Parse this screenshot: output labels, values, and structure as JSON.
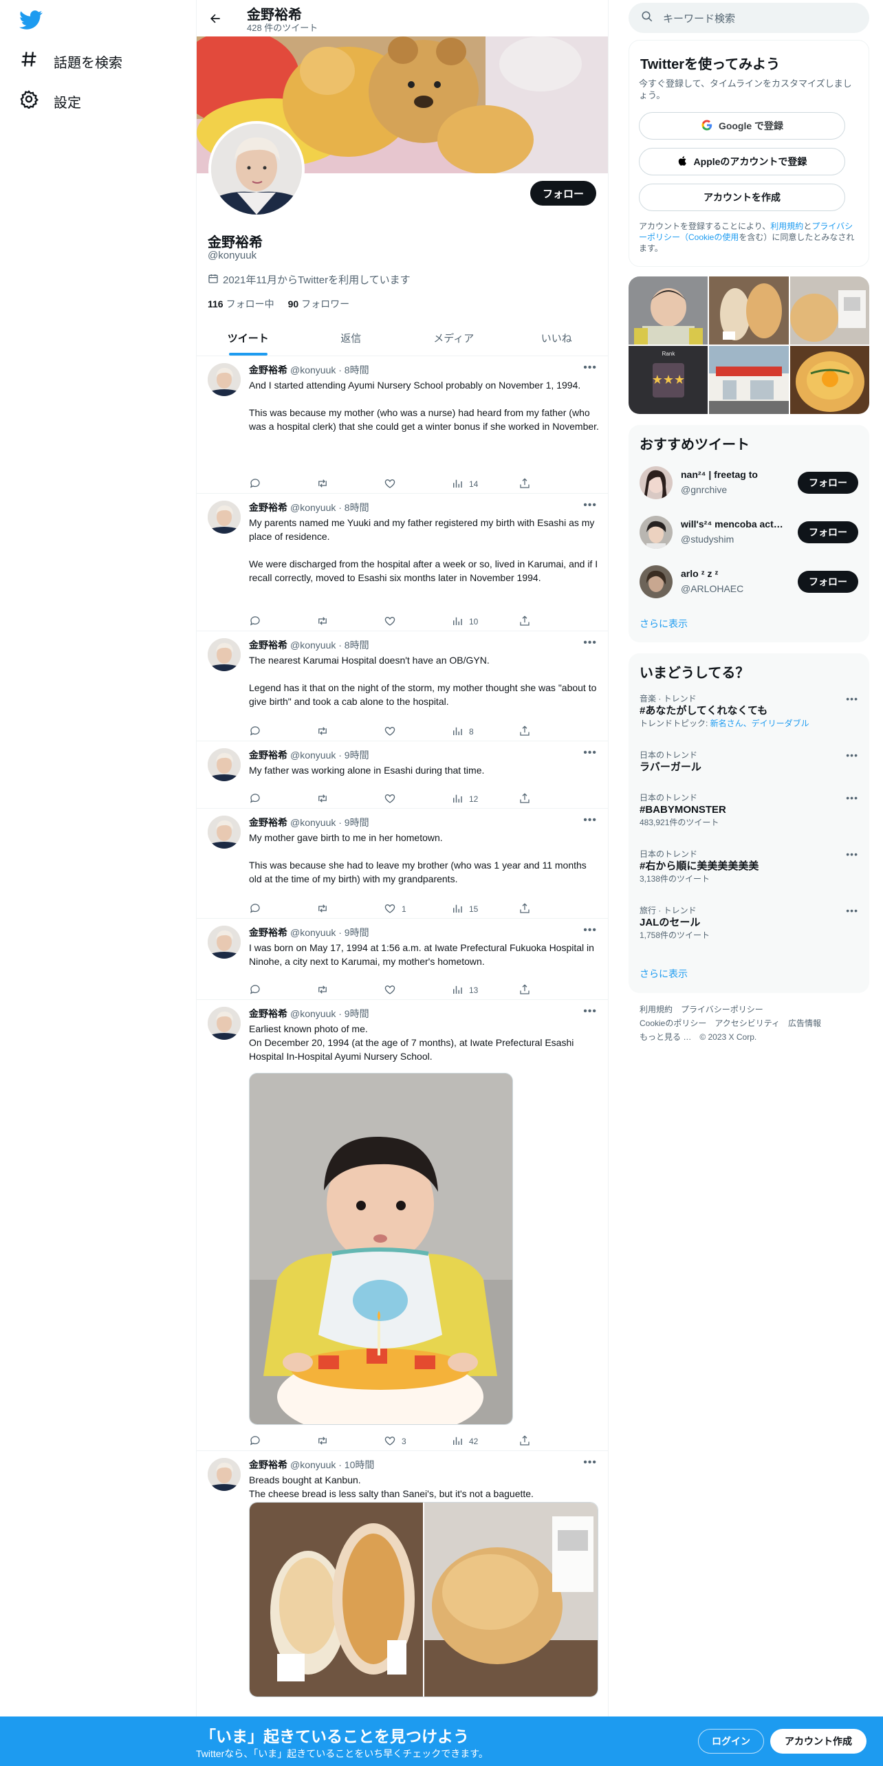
{
  "nav": {
    "logo_icon": "twitter-bird-icon",
    "items": [
      {
        "label": "話題を検索",
        "icon": "hashtag-icon"
      },
      {
        "label": "設定",
        "icon": "gear-icon"
      }
    ]
  },
  "header": {
    "name": "金野裕希",
    "tweet_count": "428 件のツイート"
  },
  "profile": {
    "name": "金野裕希",
    "handle": "@konyuuk",
    "joined": "2021年11月からTwitterを利用しています",
    "following_count": "116",
    "following_label": "フォロー中",
    "followers_count": "90",
    "followers_label": "フォロワー",
    "follow_button": "フォロー"
  },
  "tabs": [
    "ツイート",
    "返信",
    "メディア",
    "いいね"
  ],
  "tweets": [
    {
      "name": "金野裕希",
      "handle": "@konyuuk",
      "time": "· 8時間",
      "text": "And I started attending Ayumi Nursery School probably on November 1, 1994.\n\nThis was because my mother (who was a nurse) had heard from my father (who was a hospital clerk) that she could get a winter bonus if she worked in November.",
      "likes": "",
      "views": "14"
    },
    {
      "name": "金野裕希",
      "handle": "@konyuuk",
      "time": "· 8時間",
      "text": "My parents named me Yuuki and my father registered my birth with Esashi as my place of residence.\n\nWe were discharged from the hospital after a week or so, lived in Karumai, and if I recall correctly, moved to Esashi six months later in November 1994.",
      "likes": "",
      "views": "10"
    },
    {
      "name": "金野裕希",
      "handle": "@konyuuk",
      "time": "· 8時間",
      "text": "The nearest Karumai Hospital doesn't have an OB/GYN.\n\nLegend has it that on the night of the storm, my mother thought she was \"about to give birth\" and took a cab alone to the hospital.",
      "likes": "",
      "views": "8"
    },
    {
      "name": "金野裕希",
      "handle": "@konyuuk",
      "time": "· 9時間",
      "text": "My father was working alone in Esashi during that time.",
      "likes": "",
      "views": "12"
    },
    {
      "name": "金野裕希",
      "handle": "@konyuuk",
      "time": "· 9時間",
      "text": "My mother gave birth to me in her hometown.\n\nThis was because she had to leave my brother (who was 1 year and 11 months old at the time of my birth) with my grandparents.",
      "likes": "1",
      "views": "15"
    },
    {
      "name": "金野裕希",
      "handle": "@konyuuk",
      "time": "· 9時間",
      "text": "I was born on May 17, 1994 at 1:56 a.m. at Iwate Prefectural Fukuoka Hospital in Ninohe, a city next to Karumai, my mother's hometown.",
      "likes": "",
      "views": "13"
    },
    {
      "name": "金野裕希",
      "handle": "@konyuuk",
      "time": "· 9時間",
      "text": "Earliest known photo of me.\nOn December 20, 1994 (at the age of 7 months), at Iwate Prefectural Esashi Hospital In-Hospital Ayumi Nursery School.",
      "likes": "3",
      "views": "42"
    },
    {
      "name": "金野裕希",
      "handle": "@konyuuk",
      "time": "· 10時間",
      "text": "Breads bought at Kanbun.\nThe cheese bread is less salty than Sanei's, but it's not a baguette.",
      "likes": "",
      "views": ""
    }
  ],
  "search": {
    "placeholder": "キーワード検索"
  },
  "signup": {
    "title": "Twitterを使ってみよう",
    "subtitle": "今すぐ登録して、タイムラインをカスタマイズしましょう。",
    "google": "Google で登録",
    "apple": "Appleのアカウントで登録",
    "create": "アカウントを作成",
    "terms_1": "アカウントを登録することにより、",
    "terms_link1": "利用規約",
    "terms_2": "と",
    "terms_link2": "プライバシーポリシー（Cookieの使用",
    "terms_3": "を含む）に同意したとみなされます。"
  },
  "recommended": {
    "title": "おすすめツイート",
    "users": [
      {
        "name": "nan²⁴ | freetag to",
        "handle": "@gnrchive",
        "button": "フォロー"
      },
      {
        "name": "will's²⁴ mencoba acti...",
        "handle": "@studyshim",
        "button": "フォロー"
      },
      {
        "name": "arlo ᶻ z ᶻ",
        "handle": "@ARLOHAEC",
        "button": "フォロー"
      }
    ],
    "more": "さらに表示"
  },
  "trends": {
    "title": "いまどうしてる？",
    "items": [
      {
        "meta": "音楽 · トレンド",
        "name": "#あなたがしてくれなくても",
        "sub_prefix": "トレンドトピック: ",
        "sub_link": "新名さん、デイリーダブル"
      },
      {
        "meta": "日本のトレンド",
        "name": "ラバーガール",
        "sub_prefix": "",
        "sub_link": ""
      },
      {
        "meta": "日本のトレンド",
        "name": "#BABYMONSTER",
        "sub_prefix": "483,921件のツイート",
        "sub_link": ""
      },
      {
        "meta": "日本のトレンド",
        "name": "#右から順に美美美美美美",
        "sub_prefix": "3,138件のツイート",
        "sub_link": ""
      },
      {
        "meta": "旅行 · トレンド",
        "name": "JALのセール",
        "sub_prefix": "1,758件のツイート",
        "sub_link": ""
      }
    ],
    "more": "さらに表示"
  },
  "footer": {
    "line1": "利用規約　プライバシーポリシー",
    "line2": "Cookieのポリシー　アクセシビリティ　広告情報",
    "line3": "もっと見る …　© 2023 X Corp."
  },
  "bottom_bar": {
    "title": "「いま」起きていることを見つけよう",
    "subtitle": "Twitterなら、「いま」起きていることをいち早くチェックできます。",
    "login": "ログイン",
    "create": "アカウント作成"
  },
  "colors": {
    "accent": "#1d9bf0",
    "text": "#0f1419",
    "muted": "#536471"
  }
}
